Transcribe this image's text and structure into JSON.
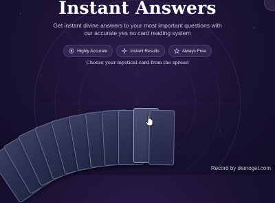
{
  "header": {
    "title": "Instant Answers",
    "subtitle": "Get instant divine answers to your most important questions with our accurate yes no card reading system"
  },
  "badges": [
    {
      "label": "Highly Accurate",
      "icon": "circle-target-icon"
    },
    {
      "label": "Instant Results",
      "icon": "sparkle-icon"
    },
    {
      "label": "Always Free",
      "icon": "star-outline-icon"
    }
  ],
  "instruction": "Choose your mystical card from the spread",
  "watermark": "Record by demoget.com",
  "colors": {
    "background": "#1a1233",
    "badge_bg": "#31264f",
    "card": "#2f3352"
  }
}
